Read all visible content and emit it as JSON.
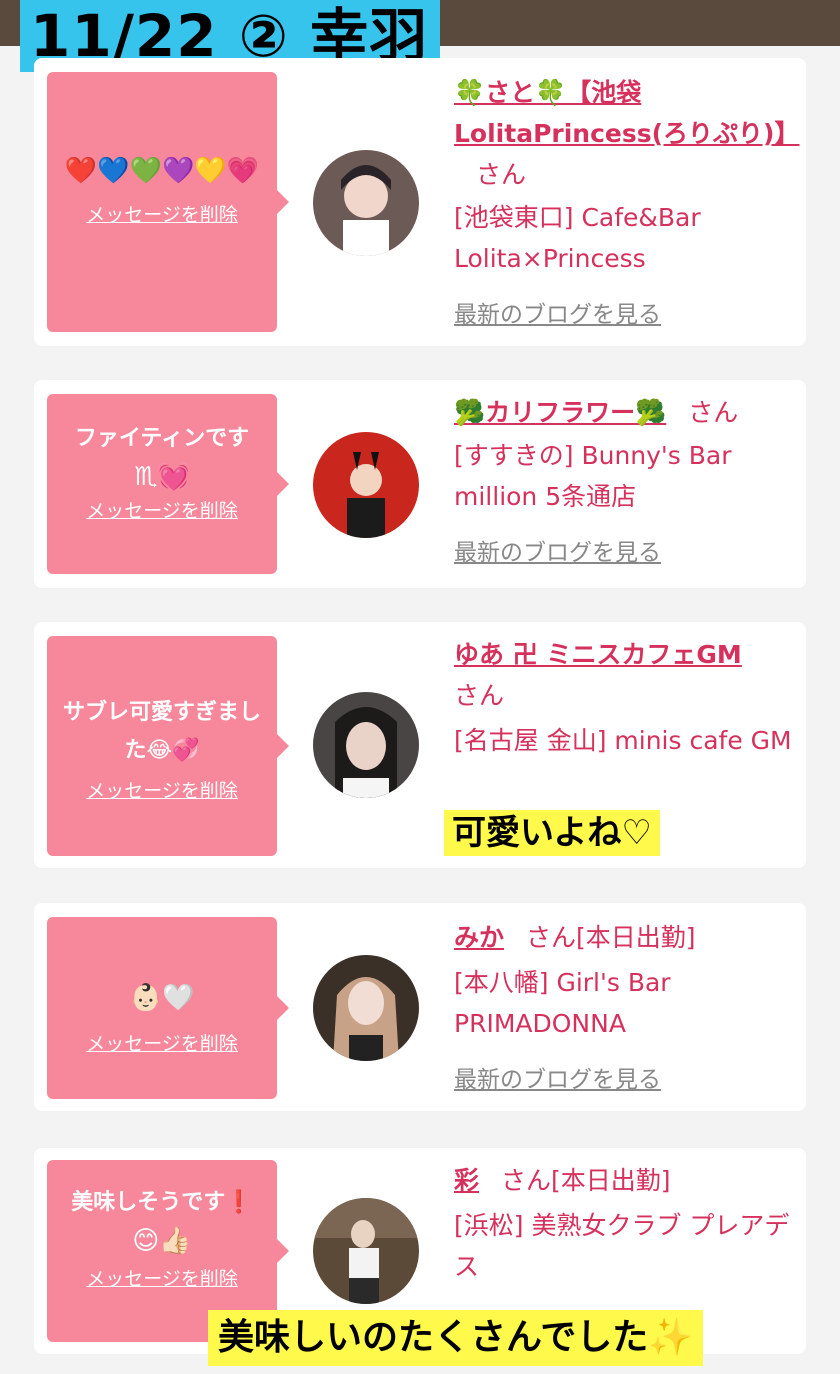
{
  "header": {
    "title": "11/22 ② 幸羽"
  },
  "cards": [
    {
      "message": "",
      "emojis": "❤️💙💚💜💛💗",
      "delete_label": "メッセージを削除",
      "name": "🍀さと🍀【池袋LolitaPrincess(ろりぷり)】",
      "honorific": "さん",
      "shop": "[池袋東口] Cafe&Bar Lolita×Princess",
      "blog_label": "最新のブログを見る"
    },
    {
      "message": "ファイティンです",
      "emojis": "♏💓",
      "delete_label": "メッセージを削除",
      "name": "🥦カリフラワー🥦",
      "honorific": "さん",
      "shop": "[すすきの] Bunny's Bar million 5条通店",
      "blog_label": "最新のブログを見る"
    },
    {
      "message": "サブレ可愛すぎました😂💞",
      "emojis": "",
      "delete_label": "メッセージを削除",
      "name": "ゆあ 卍 ミニスカフェGM",
      "honorific": "さん",
      "shop": "[名古屋 金山] minis cafe GM",
      "blog_label": ""
    },
    {
      "message": "",
      "emojis": "👶🏻🤍",
      "delete_label": "メッセージを削除",
      "name": "みか",
      "honorific": "さん[本日出勤]",
      "shop": "[本八幡] Girl's Bar PRIMADONNA",
      "blog_label": "最新のブログを見る"
    },
    {
      "message": "美味しそうです❗️",
      "emojis": "😊👍🏻",
      "delete_label": "メッセージを削除",
      "name": "彩",
      "honorific": "さん[本日出勤]",
      "shop": "[浜松] 美熟女クラブ プレアデス",
      "blog_label": ""
    }
  ],
  "notes": {
    "note1": "可愛いよね♡",
    "note2": "美味しいのたくさんでした✨"
  },
  "colors": {
    "bubble": "#f7879a",
    "accent": "#d6315c",
    "header_bar": "#5a4a3e",
    "title_bg": "#36c3ec",
    "note_bg": "#fef94a"
  }
}
